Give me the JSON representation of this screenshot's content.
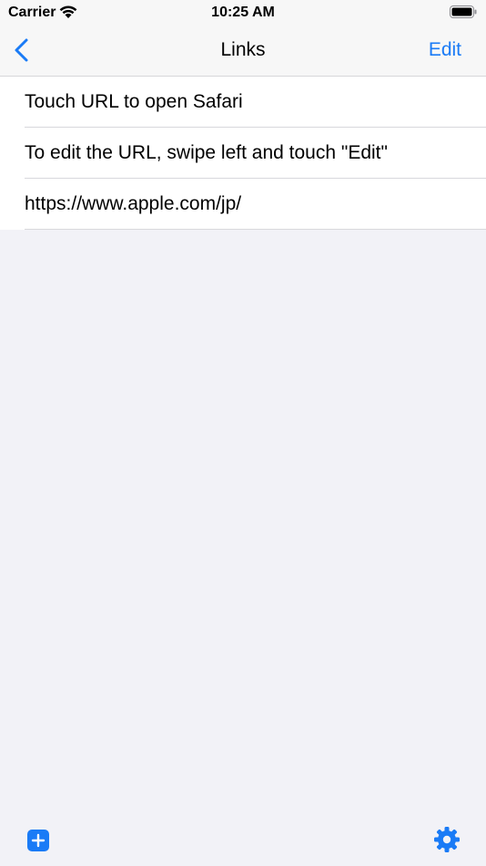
{
  "colors": {
    "accent": "#1a7bf6",
    "background": "#f2f2f7",
    "row_background": "#ffffff",
    "separator": "#d8d8dc"
  },
  "status_bar": {
    "carrier": "Carrier",
    "time": "10:25 AM",
    "wifi_icon": "wifi-icon",
    "battery_icon": "battery-icon"
  },
  "nav": {
    "back_icon": "chevron-left-icon",
    "title": "Links",
    "edit_label": "Edit"
  },
  "rows": [
    {
      "label": "Touch URL to open Safari"
    },
    {
      "label": "To edit the URL, swipe left and touch \"Edit\""
    },
    {
      "label": "https://www.apple.com/jp/"
    }
  ],
  "toolbar": {
    "add_icon": "plus-square-icon",
    "settings_icon": "gear-icon"
  }
}
